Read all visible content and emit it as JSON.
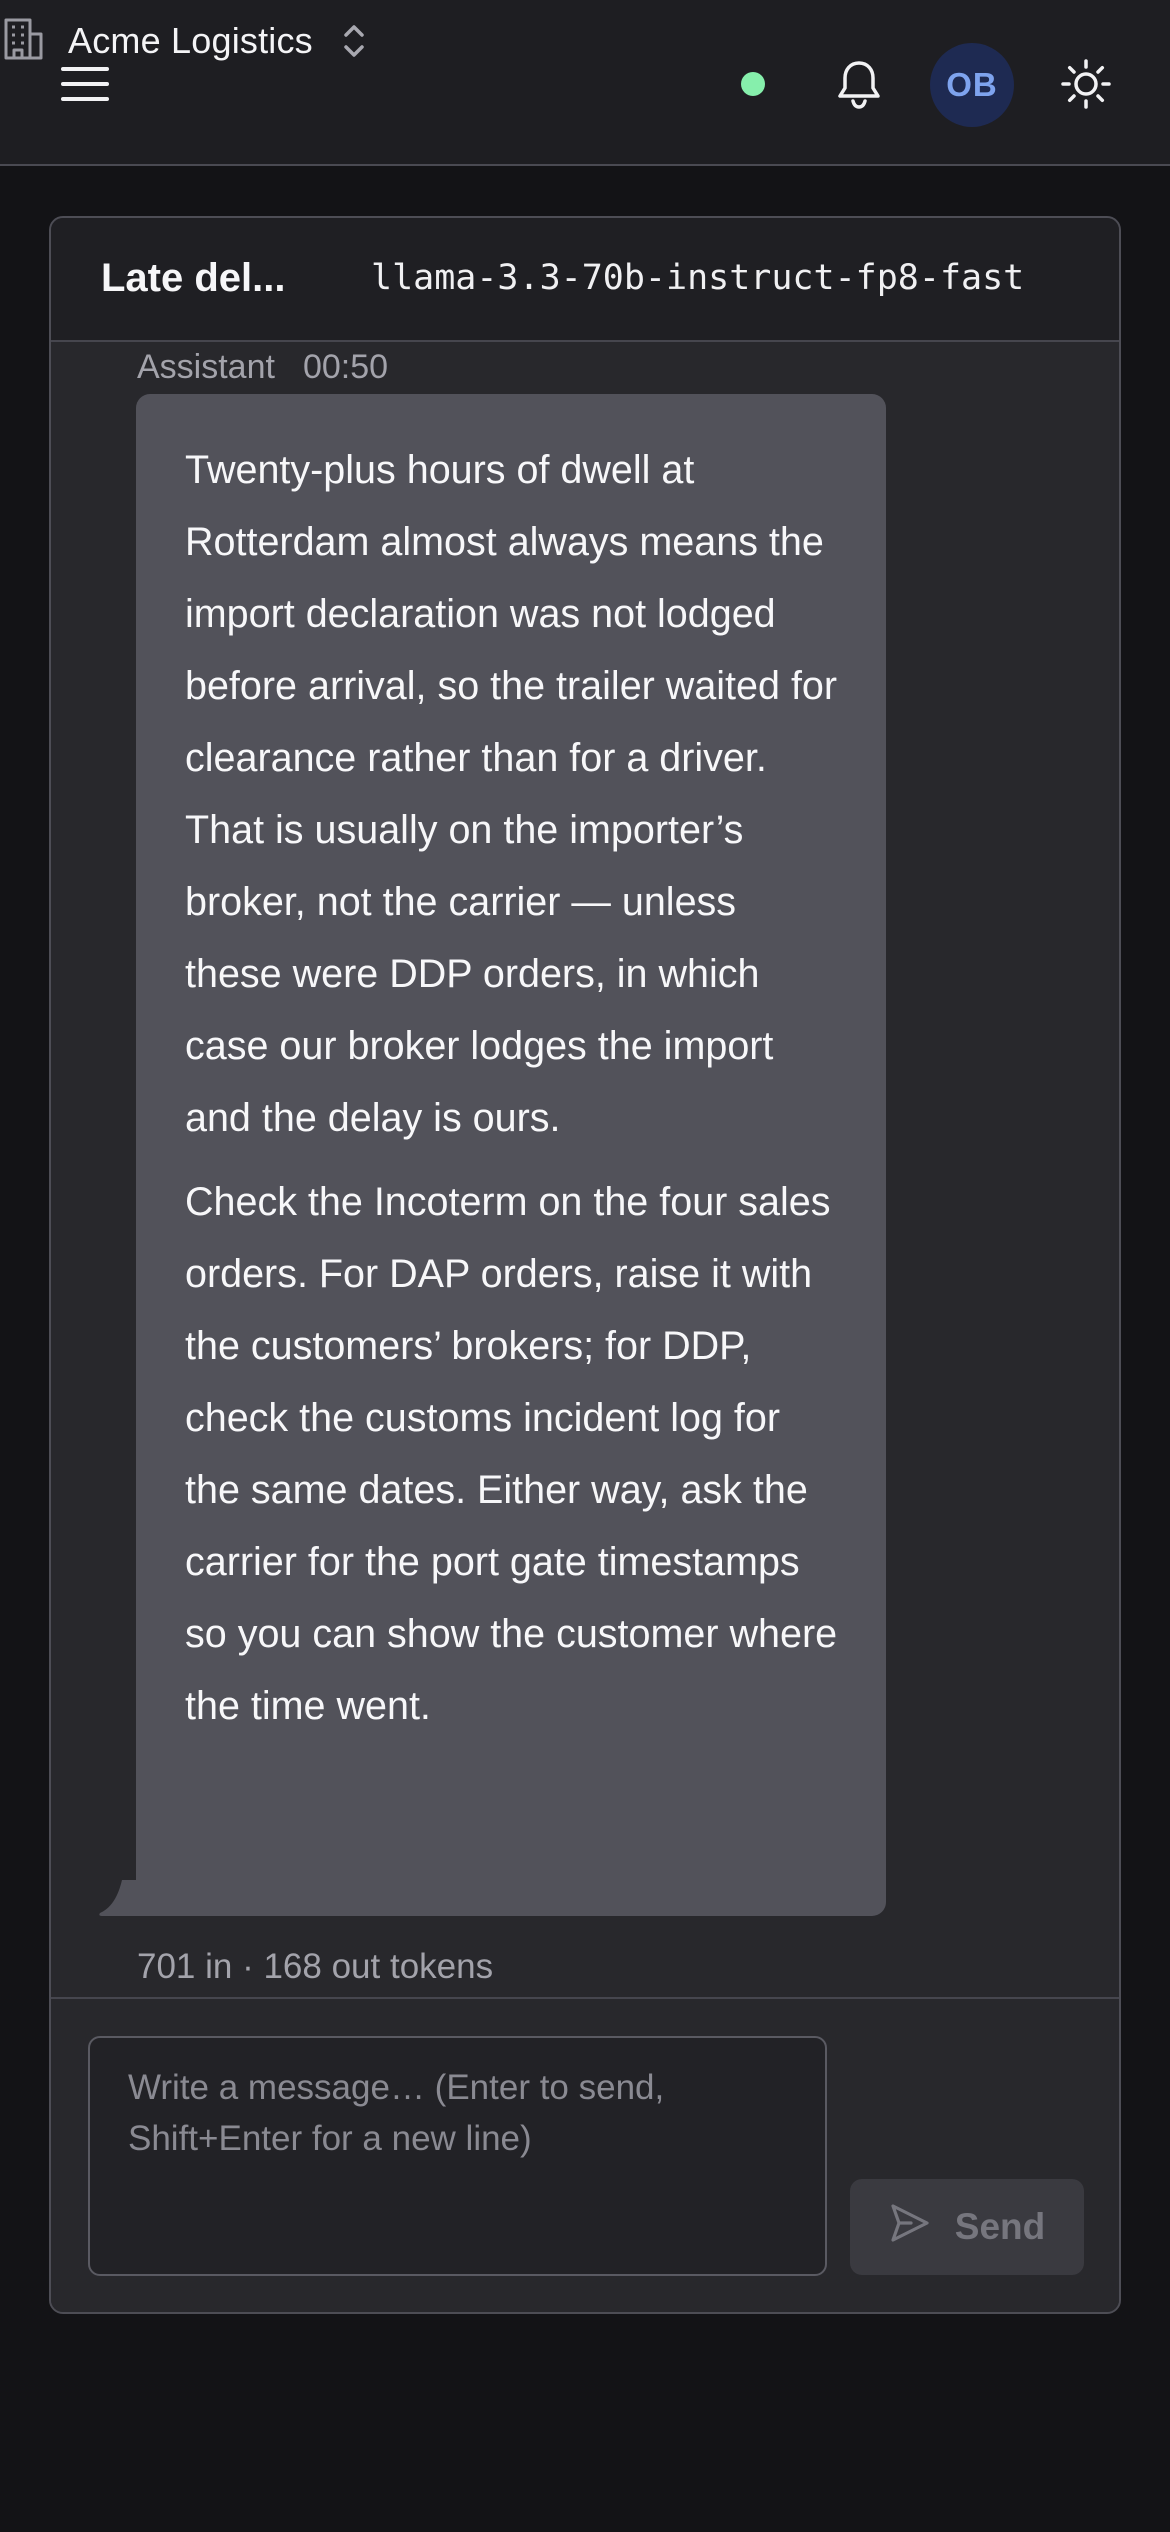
{
  "topbar": {
    "menu_icon": "hamburger-menu-icon",
    "org_icon": "building-icon",
    "org_name": "Acme Logistics",
    "org_switch_icon": "chevron-up-down-icon",
    "status_color": "#86efac",
    "bell_icon": "bell-icon",
    "avatar_initials": "OB",
    "theme_icon": "sun-icon"
  },
  "conversation": {
    "title": "Late del...",
    "model": "llama-3.3-70b-instruct-fp8-fast"
  },
  "message": {
    "role": "Assistant",
    "time": "00:50",
    "paragraphs": [
      "Twenty-plus hours of dwell at Rotterdam almost always means the import declaration was not lodged before arrival, so the trailer waited for clearance rather than for a driver. That is usually on the importer’s broker, not the carrier — unless these were DDP orders, in which case our broker lodges the import and the delay is ours.",
      "Check the Incoterm on the four sales orders. For DAP orders, raise it with the customers’ brokers; for DDP, check the customs incident log for the same dates. Either way, ask the carrier for the port gate timestamps so you can show the customer where the time went."
    ],
    "usage": "701 in · 168 out tokens"
  },
  "composer": {
    "placeholder": "Write a message… (Enter to send, Shift+Enter for a new line)",
    "value": "",
    "send_label": "Send",
    "send_icon": "send-icon"
  }
}
